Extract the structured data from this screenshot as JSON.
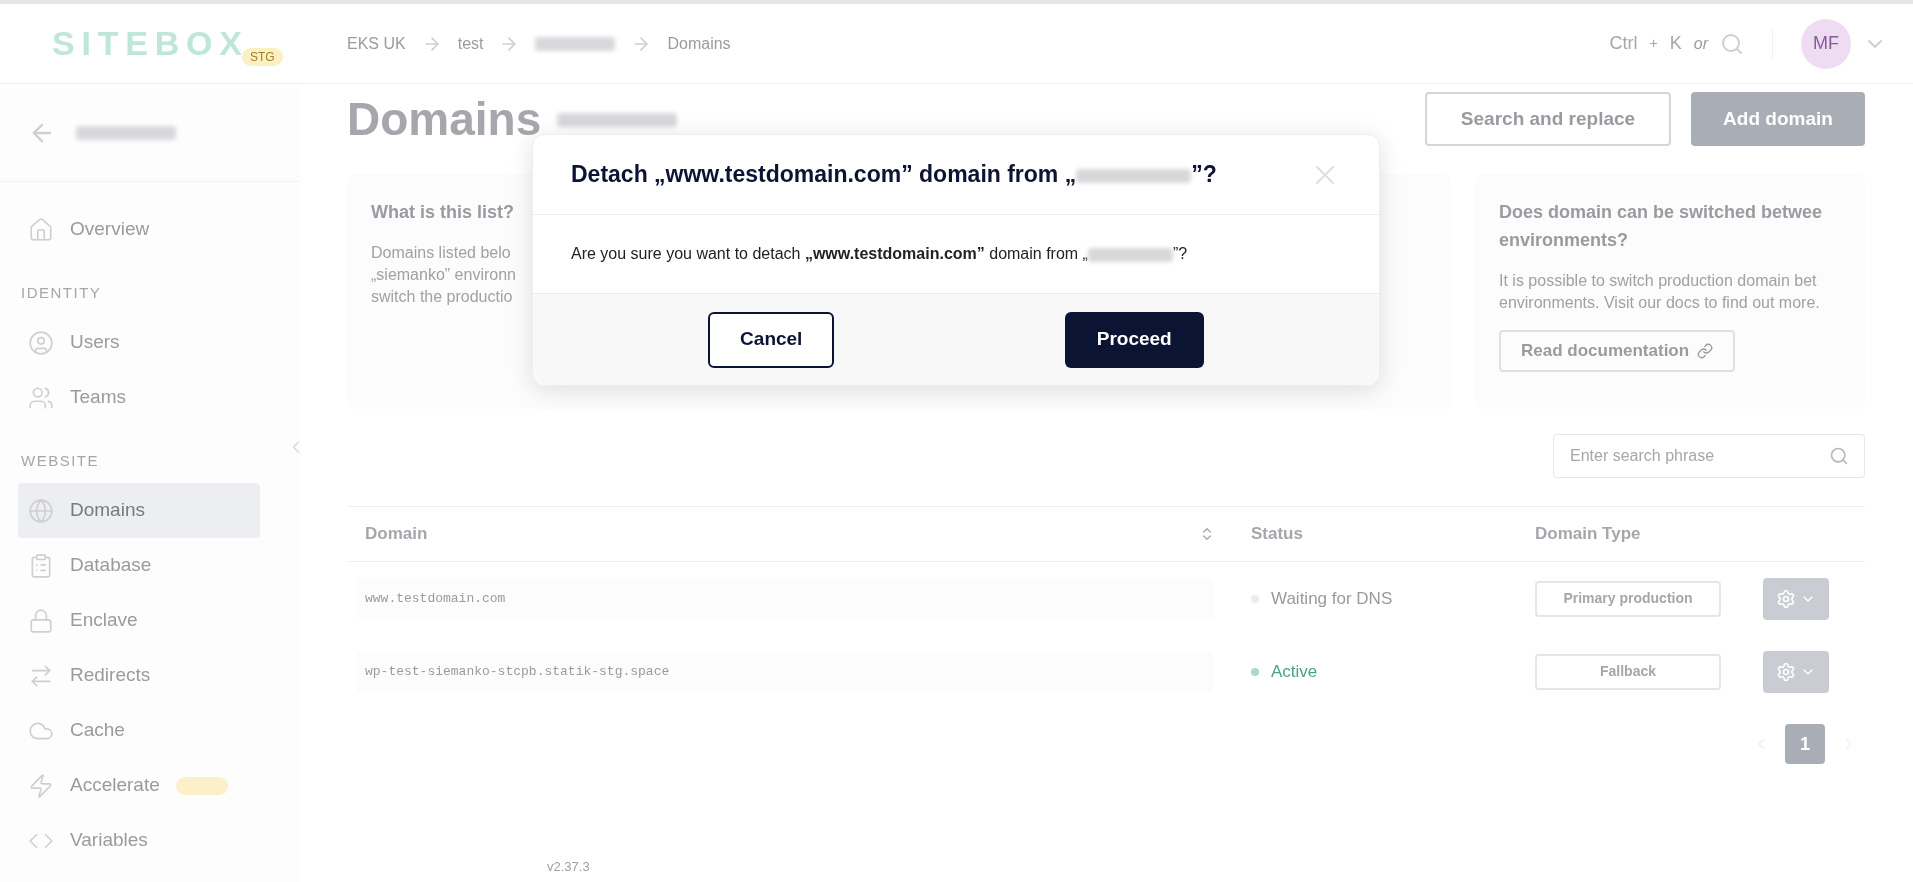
{
  "header": {
    "logo": "SITEBOX",
    "env_badge": "STG",
    "breadcrumbs": [
      {
        "kind": "text",
        "label": "EKS UK"
      },
      {
        "kind": "text",
        "label": "test"
      },
      {
        "kind": "redacted"
      },
      {
        "kind": "text",
        "label": "Domains"
      }
    ],
    "shortcut": {
      "keys": [
        "Ctrl",
        "K"
      ],
      "plus": "+",
      "or": "or"
    },
    "avatar": "MF"
  },
  "sidebar": {
    "sections": [
      {
        "items": [
          {
            "label": "Overview",
            "selected": false
          }
        ]
      },
      {
        "heading": "IDENTITY",
        "items": [
          {
            "label": "Users",
            "selected": false
          },
          {
            "label": "Teams",
            "selected": false
          }
        ]
      },
      {
        "heading": "WEBSITE",
        "items": [
          {
            "label": "Domains",
            "selected": true
          },
          {
            "label": "Database",
            "selected": false
          },
          {
            "label": "Enclave",
            "selected": false
          },
          {
            "label": "Redirects",
            "selected": false
          },
          {
            "label": "Cache",
            "selected": false
          },
          {
            "label": "Accelerate",
            "selected": false,
            "badge": true
          },
          {
            "label": "Variables",
            "selected": false
          }
        ]
      }
    ]
  },
  "page": {
    "title": "Domains",
    "buttons": [
      {
        "kind": "outline",
        "label": "Search and replace"
      },
      {
        "kind": "filled",
        "label": "Add domain"
      }
    ]
  },
  "cards": [
    {
      "title": "What is this list?",
      "lines": [
        "Domains listed belo",
        "„siemanko” environn",
        "switch the productio"
      ]
    },
    {
      "title": "Does domain can be switched betwee environments?",
      "lines": [
        "It is possible to switch production domain bet",
        "environments. Visit our docs to find out more."
      ],
      "button": "Read documentation"
    }
  ],
  "search": {
    "placeholder": "Enter search phrase"
  },
  "table": {
    "columns": [
      "Domain",
      "Status",
      "Domain Type"
    ],
    "rows": [
      {
        "domain": "www.testdomain.com",
        "status": "Waiting for DNS",
        "color": "#ececec",
        "type": "Primary production"
      },
      {
        "domain": "wp-test-siemanko-stcpb.statik-stg.space",
        "status": "Active",
        "color": "#a8dcc4",
        "type": "Fallback"
      }
    ]
  },
  "pagination": [
    {
      "label": "1",
      "selected": true
    }
  ],
  "footer": {
    "version": "v2.37.3"
  },
  "dialog": {
    "title_start": "Detach „www.testdomain.com” domain from „",
    "title_end": "”?",
    "body_start": "Are you sure you want to detach **„www.testdomain.com”** domain from „",
    "body_end": "”?",
    "cancel": "Cancel",
    "proceed": "Proceed"
  }
}
